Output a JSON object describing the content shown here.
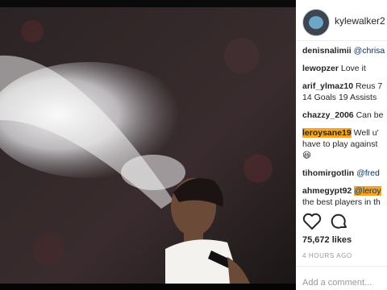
{
  "post": {
    "username": "kylewalker2",
    "likes": "75,672 likes",
    "time": "4 HOURS AGO",
    "add_comment_placeholder": "Add a comment..."
  },
  "comments": [
    {
      "user": "denisnalimii",
      "text": "@chrisa"
    },
    {
      "user": "lewopzer",
      "text": "Love it"
    },
    {
      "user": "arif_ylmaz10",
      "text": "Reus 7",
      "line2": "14 Goals 19 Assists"
    },
    {
      "user": "chazzy_2006",
      "text": "Can be"
    },
    {
      "user": "leroysane19",
      "text": "Well u'",
      "line2": "have to play against",
      "line3": "😆"
    },
    {
      "user": "tihomirgotlin",
      "text": "@fred"
    },
    {
      "user": "ahmegypt92",
      "text": "@leroy",
      "line2": "the best players in th"
    }
  ],
  "icons": {
    "avatar": "profile-avatar",
    "like": "heart-icon",
    "comment": "comment-icon"
  },
  "colors": {
    "highlight": "#f6a623",
    "mention": "#003569"
  }
}
